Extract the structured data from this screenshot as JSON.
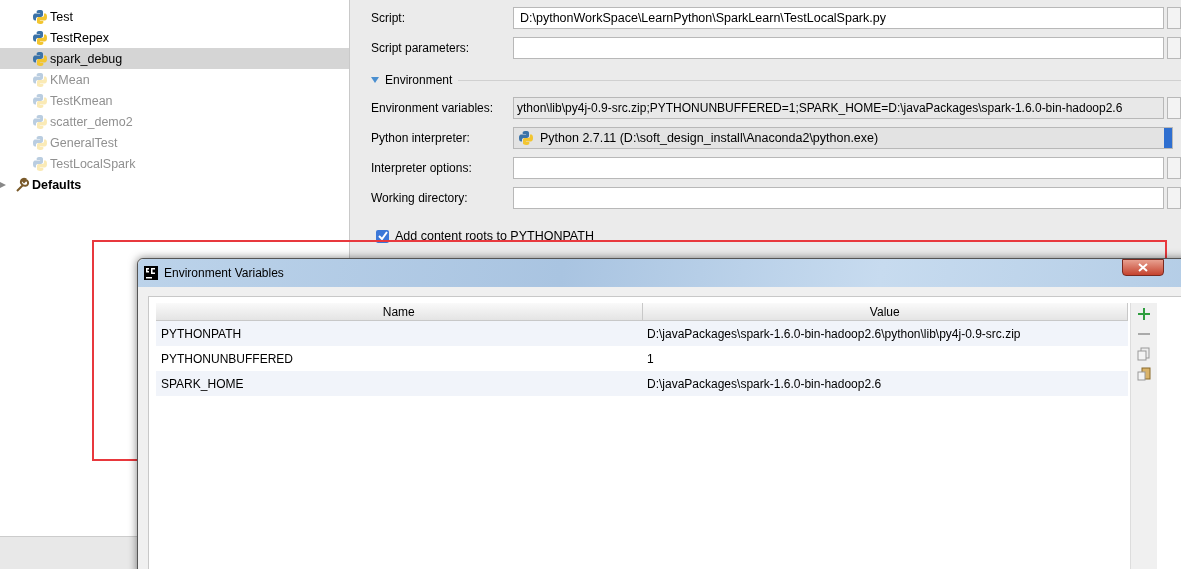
{
  "tree": [
    {
      "kind": "config",
      "label": "Test",
      "selected": false,
      "disabled": false
    },
    {
      "kind": "config",
      "label": "TestRepex",
      "selected": false,
      "disabled": false
    },
    {
      "kind": "config",
      "label": "spark_debug",
      "selected": true,
      "disabled": false
    },
    {
      "kind": "config",
      "label": "KMean",
      "selected": false,
      "disabled": true
    },
    {
      "kind": "config",
      "label": "TestKmean",
      "selected": false,
      "disabled": true
    },
    {
      "kind": "config",
      "label": "scatter_demo2",
      "selected": false,
      "disabled": true
    },
    {
      "kind": "config",
      "label": "GeneralTest",
      "selected": false,
      "disabled": true
    },
    {
      "kind": "config",
      "label": "TestLocalSpark",
      "selected": false,
      "disabled": true
    },
    {
      "kind": "defaults",
      "label": "Defaults",
      "selected": false,
      "disabled": false
    }
  ],
  "form": [
    {
      "kind": "field",
      "label": "Script:",
      "value": "D:\\pythonWorkSpace\\LearnPython\\SparkLearn\\TestLocalSpark.py"
    },
    {
      "kind": "field",
      "label": "Script parameters:"
    },
    {
      "kind": "section",
      "label": "Environment",
      "expanded": true
    },
    {
      "kind": "readonly",
      "label": "Environment variables:",
      "value": "ython\\lib\\py4j-0.9-src.zip;PYTHONUNBUFFERED=1;SPARK_HOME=D:\\javaPackages\\spark-1.6.0-bin-hadoop2.6"
    },
    {
      "kind": "dropdown",
      "label": "Python interpreter:",
      "value": "Python 2.7.11 (D:\\soft_design_install\\Anaconda2\\python.exe)"
    },
    {
      "kind": "field",
      "label": "Interpreter options:"
    },
    {
      "kind": "field",
      "label": "Working directory:"
    },
    {
      "kind": "checkbox",
      "label": "Add content roots to PYTHONPATH",
      "checked": true
    }
  ],
  "dialog": {
    "title": "Environment Variables",
    "columns": [
      "Name",
      "Value"
    ],
    "rows": [
      {
        "name": "PYTHONPATH",
        "value": "D:\\javaPackages\\spark-1.6.0-bin-hadoop2.6\\python\\lib\\py4j-0.9-src.zip"
      },
      {
        "name": "PYTHONUNBUFFERED",
        "value": "1"
      },
      {
        "name": "SPARK_HOME",
        "value": "D:\\javaPackages\\spark-1.6.0-bin-hadoop2.6"
      }
    ]
  }
}
